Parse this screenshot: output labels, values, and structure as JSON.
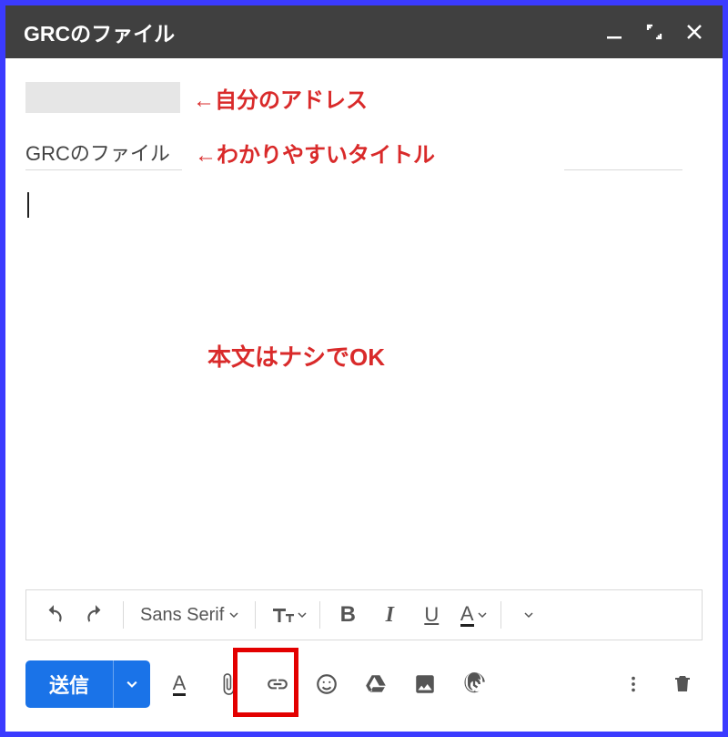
{
  "titlebar": {
    "title": "GRCのファイル"
  },
  "to": {
    "annotation": "←自分のアドレス"
  },
  "subject": {
    "value": "GRCのファイル",
    "annotation": "←わかりやすいタイトル"
  },
  "body": {
    "annotation": "本文はナシでOK"
  },
  "format_bar": {
    "font_family": "Sans Serif",
    "bold": "B",
    "italic": "I",
    "underline": "U",
    "text_color": "A"
  },
  "action_bar": {
    "send_label": "送信",
    "format_toggle": "A"
  }
}
